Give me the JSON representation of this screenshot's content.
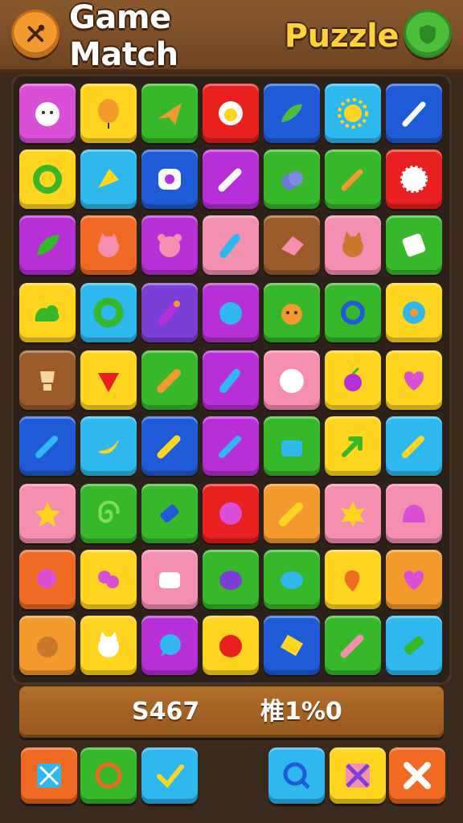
{
  "header": {
    "title_part1": "Game Match",
    "title_part2": "Puzzle",
    "left_icon": "tools-icon",
    "right_icon": "shield-icon"
  },
  "board": {
    "rows": [
      [
        {
          "bg": "#d94fd6",
          "icon": "fluffy-creature-icon"
        },
        {
          "bg": "#ffd51f",
          "icon": "balloon-icon"
        },
        {
          "bg": "#36b82a",
          "icon": "paper-plane-icon"
        },
        {
          "bg": "#ea1f1f",
          "icon": "egg-icon"
        },
        {
          "bg": "#1f5bd6",
          "icon": "pepper-icon"
        },
        {
          "bg": "#2fb8ee",
          "icon": "sun-icon"
        },
        {
          "bg": "#1f5bd6",
          "icon": "brush-icon"
        }
      ],
      [
        {
          "bg": "#ffd51f",
          "icon": "ring-icon"
        },
        {
          "bg": "#2fb8ee",
          "icon": "arrow-icon"
        },
        {
          "bg": "#1f5bd6",
          "icon": "eye-bot-icon"
        },
        {
          "bg": "#b72fd6",
          "icon": "marker-icon"
        },
        {
          "bg": "#36b82a",
          "icon": "berry-icon"
        },
        {
          "bg": "#36b82a",
          "icon": "pencil-icon"
        },
        {
          "bg": "#ea1f1f",
          "icon": "puffball-icon"
        }
      ],
      [
        {
          "bg": "#b72fd6",
          "icon": "leaf-icon"
        },
        {
          "bg": "#f06a24",
          "icon": "cat-icon"
        },
        {
          "bg": "#b72fd6",
          "icon": "bear-icon"
        },
        {
          "bg": "#f58fb0",
          "icon": "bottle-icon"
        },
        {
          "bg": "#9a5a2a",
          "icon": "eraser-icon"
        },
        {
          "bg": "#f58fb0",
          "icon": "fox-icon"
        },
        {
          "bg": "#36b82a",
          "icon": "card-icon"
        }
      ],
      [
        {
          "bg": "#ffd51f",
          "icon": "bush-icon"
        },
        {
          "bg": "#2fb8ee",
          "icon": "donut-icon"
        },
        {
          "bg": "#7a3fd6",
          "icon": "glue-icon"
        },
        {
          "bg": "#b72fd6",
          "icon": "blob-icon"
        },
        {
          "bg": "#36b82a",
          "icon": "dog-icon"
        },
        {
          "bg": "#36b82a",
          "icon": "gear-ring-icon"
        },
        {
          "bg": "#ffd51f",
          "icon": "flower-icon"
        }
      ],
      [
        {
          "bg": "#9a5a2a",
          "icon": "trophy-icon"
        },
        {
          "bg": "#ffd51f",
          "icon": "watermelon-icon"
        },
        {
          "bg": "#36b82a",
          "icon": "carrot-icon"
        },
        {
          "bg": "#b72fd6",
          "icon": "tube-icon"
        },
        {
          "bg": "#f58fb0",
          "icon": "sheep-icon"
        },
        {
          "bg": "#ffd51f",
          "icon": "cherry-icon"
        },
        {
          "bg": "#ffd51f",
          "icon": "heart-icon"
        }
      ],
      [
        {
          "bg": "#1f5bd6",
          "icon": "pen-icon"
        },
        {
          "bg": "#2fb8ee",
          "icon": "banana-icon"
        },
        {
          "bg": "#1f5bd6",
          "icon": "crayon-icon"
        },
        {
          "bg": "#b72fd6",
          "icon": "syringe-icon"
        },
        {
          "bg": "#36b82a",
          "icon": "bag-icon"
        },
        {
          "bg": "#ffd51f",
          "icon": "arrow-up-icon"
        },
        {
          "bg": "#2fb8ee",
          "icon": "pen-gold-icon"
        }
      ],
      [
        {
          "bg": "#f58fb0",
          "icon": "star-icon"
        },
        {
          "bg": "#36b82a",
          "icon": "swirl-icon"
        },
        {
          "bg": "#36b82a",
          "icon": "eraser-blue-icon"
        },
        {
          "bg": "#ea1f1f",
          "icon": "ball-icon"
        },
        {
          "bg": "#f29a2e",
          "icon": "glue-stick-icon"
        },
        {
          "bg": "#f58fb0",
          "icon": "star-burst-icon"
        },
        {
          "bg": "#f58fb0",
          "icon": "slime-icon"
        }
      ],
      [
        {
          "bg": "#f06a24",
          "icon": "rose-icon"
        },
        {
          "bg": "#ffd51f",
          "icon": "roses-icon"
        },
        {
          "bg": "#f58fb0",
          "icon": "marshmallow-icon"
        },
        {
          "bg": "#36b82a",
          "icon": "plum-icon"
        },
        {
          "bg": "#36b82a",
          "icon": "fish-icon"
        },
        {
          "bg": "#ffd51f",
          "icon": "leaf-heart-icon"
        },
        {
          "bg": "#f29a2e",
          "icon": "heart-purple-icon"
        }
      ],
      [
        {
          "bg": "#f29a2e",
          "icon": "hamster-icon"
        },
        {
          "bg": "#ffd51f",
          "icon": "kitten-icon"
        },
        {
          "bg": "#b72fd6",
          "icon": "speech-bubble-icon"
        },
        {
          "bg": "#ffd51f",
          "icon": "apple-icon"
        },
        {
          "bg": "#1f5bd6",
          "icon": "cheese-icon"
        },
        {
          "bg": "#36b82a",
          "icon": "marker-pink-icon"
        },
        {
          "bg": "#2fb8ee",
          "icon": "battery-icon"
        }
      ]
    ]
  },
  "score": {
    "left": "S467",
    "right": "椎1%0"
  },
  "bottom_buttons": [
    {
      "bg": "#f06a24",
      "icon": "shuffle-icon"
    },
    {
      "bg": "#36b82a",
      "icon": "refresh-icon"
    },
    {
      "bg": "#2fb8ee",
      "icon": "check-icon"
    },
    {
      "bg": "#2fb8ee",
      "icon": "search-icon"
    },
    {
      "bg": "#ffd51f",
      "icon": "crossed-tools-icon"
    },
    {
      "bg": "#f06a24",
      "icon": "close-icon"
    }
  ]
}
